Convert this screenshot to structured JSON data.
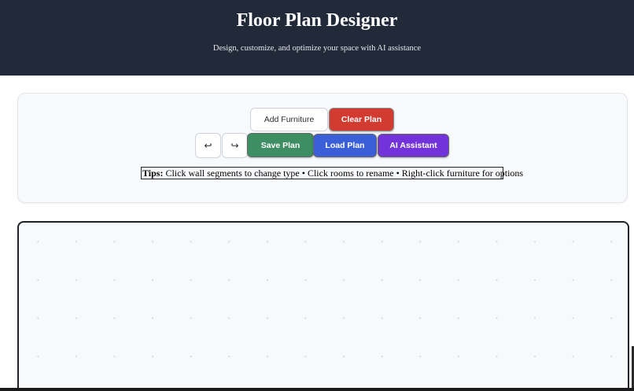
{
  "header": {
    "title": "Floor Plan Designer",
    "subtitle": "Design, customize, and optimize your space with AI assistance"
  },
  "toolbar": {
    "add_furniture": "Add Furniture",
    "clear_plan": "Clear Plan",
    "undo_glyph": "↩",
    "redo_glyph": "↪",
    "save_plan": "Save Plan",
    "load_plan": "Load Plan",
    "ai_assistant": "AI Assistant"
  },
  "tips": {
    "label": "Tips:",
    "text": " Click wall segments to change type • Click rooms to rename • Right-click furniture for options"
  },
  "icons": {
    "undo": "undo-icon",
    "redo": "redo-icon"
  },
  "colors": {
    "header_bg": "#222a3a",
    "clear_plan": "#d23b30",
    "save_plan": "#3e8e64",
    "load_plan": "#3b5fd8",
    "ai_assistant": "#7233db"
  }
}
